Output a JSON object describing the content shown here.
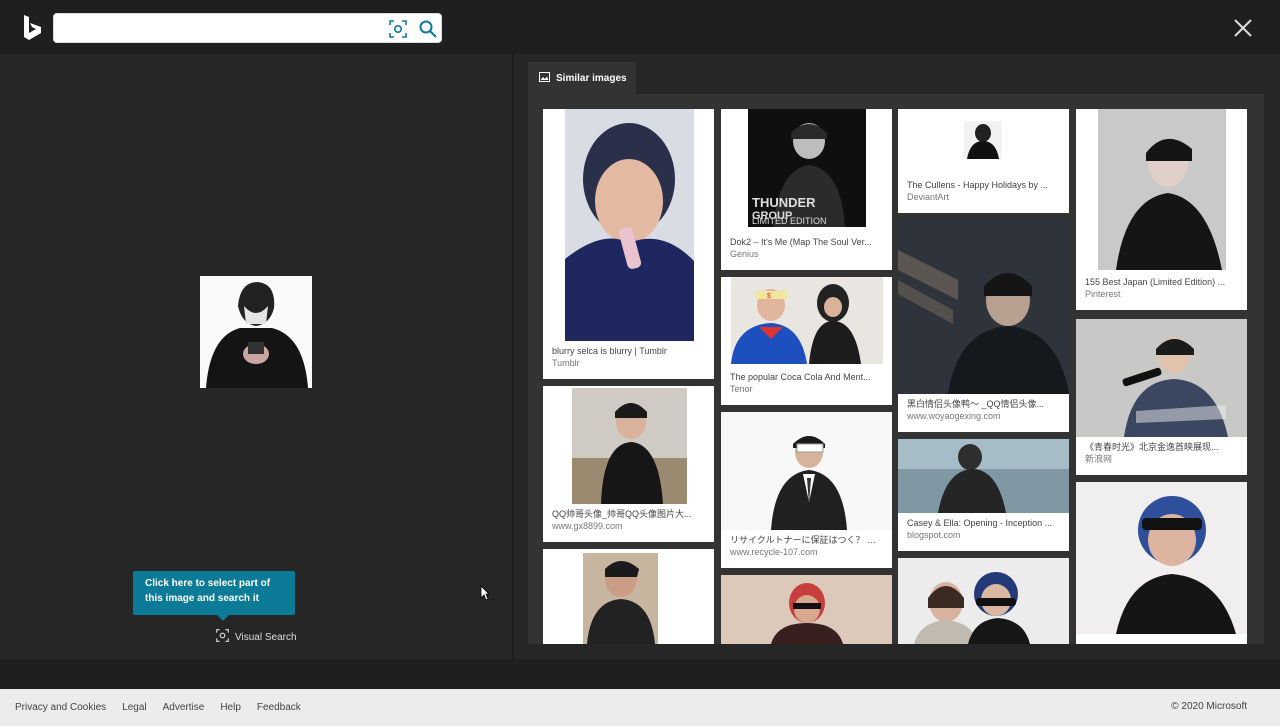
{
  "header": {
    "search_value": "",
    "logo_icon": "bing-logo-icon",
    "visual_search_icon": "visual-search-icon",
    "search_icon": "search-icon",
    "close_icon": "close-icon"
  },
  "left": {
    "tooltip_text": "Click here to select part of this image and search it",
    "visual_search_label": "Visual Search"
  },
  "right": {
    "tab_label": "Similar images",
    "cards": [
      {
        "caption": "blurry selca is blurry | Tumblr",
        "source": "Tumblr"
      },
      {
        "caption": "Dok2 – It's Me (Map The Soul Ver...",
        "source": "Genius"
      },
      {
        "caption": "The Cullens - Happy Holidays by ...",
        "source": "DeviantArt"
      },
      {
        "caption": "155 Best Japan (Limited Edition) ...",
        "source": "Pinterest"
      },
      {
        "caption": "The popular Coca Cola And Ment...",
        "source": "Tenor"
      },
      {
        "caption": "黑白情侣头像鸭～ _QQ情侣头像...",
        "source": "www.woyaogexing.com"
      },
      {
        "caption": "《青春时光》北京金逸首映展现...",
        "source": "新浪网"
      },
      {
        "caption": "QQ帅哥头像_帅哥QQ头像图片大...",
        "source": "www.gx8899.com"
      },
      {
        "caption": "リサイクルトナーに保証はつく？ 故障...",
        "source": "www.recycle-107.com"
      },
      {
        "caption": "Casey & Ella: Opening - Inception ...",
        "source": "blogspot.com"
      }
    ],
    "thumb_text": {
      "dok2_line1": "THUNDER",
      "dok2_line2": "GROUP",
      "dok2_line3": "LIMITED EDITION",
      "coke_badge": "$"
    }
  },
  "footer": {
    "links": [
      "Privacy and Cookies",
      "Legal",
      "Advertise",
      "Help",
      "Feedback"
    ],
    "copyright": "© 2020 Microsoft"
  }
}
